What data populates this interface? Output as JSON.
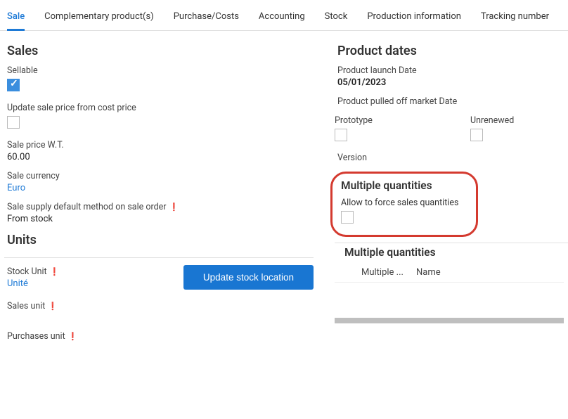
{
  "tabs": {
    "sale": "Sale",
    "complementary": "Complementary product(s)",
    "purchase": "Purchase/Costs",
    "accounting": "Accounting",
    "stock": "Stock",
    "production": "Production information",
    "tracking": "Tracking number"
  },
  "sales": {
    "title": "Sales",
    "sellable_label": "Sellable",
    "update_from_cost_label": "Update sale price from cost price",
    "sale_price_label": "Sale price W.T.",
    "sale_price_value": "60.00",
    "sale_currency_label": "Sale currency",
    "sale_currency_value": "Euro",
    "supply_method_label": "Sale supply default method on sale order",
    "supply_method_value": "From stock"
  },
  "units": {
    "title": "Units",
    "stock_unit_label": "Stock Unit",
    "stock_unit_value": "Unité",
    "update_stock_btn": "Update stock location",
    "sales_unit_label": "Sales unit",
    "purchases_unit_label": "Purchases unit"
  },
  "dates": {
    "title": "Product dates",
    "launch_label": "Product launch Date",
    "launch_value": "05/01/2023",
    "pulled_label": "Product pulled off market Date",
    "prototype_label": "Prototype",
    "unrenewed_label": "Unrenewed",
    "version_label": "Version"
  },
  "multi": {
    "callout_title": "Multiple quantities",
    "callout_text": "Allow to force sales quantities",
    "table_title": "Multiple quantities",
    "col_multiple": "Multiple ...",
    "col_name": "Name"
  }
}
